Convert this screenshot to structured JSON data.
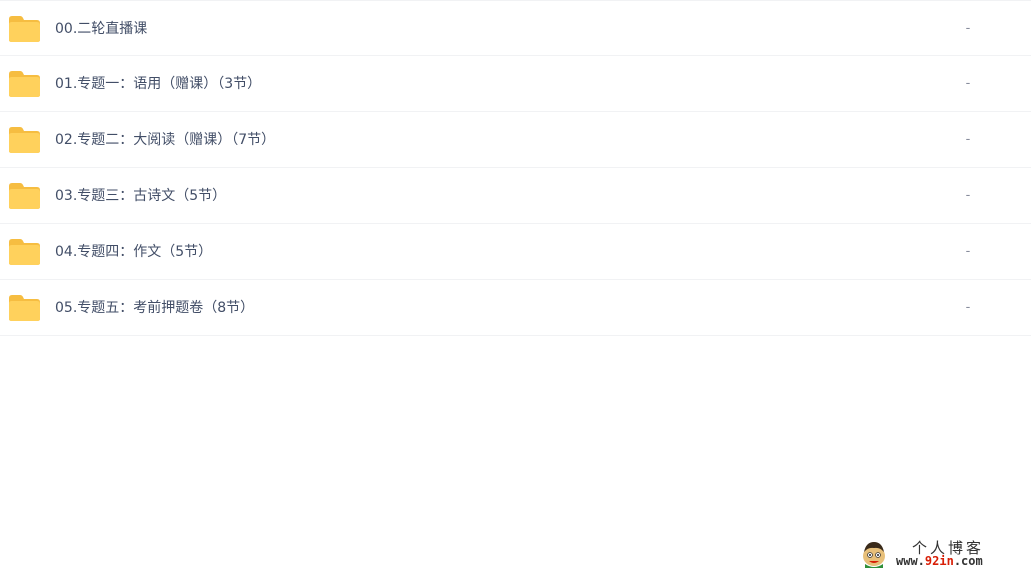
{
  "files": [
    {
      "name": "00.二轮直播课",
      "size": "-",
      "icon": "folder-icon"
    },
    {
      "name": "01.专题一：语用（赠课）（3节）",
      "size": "-",
      "icon": "folder-icon"
    },
    {
      "name": "02.专题二：大阅读（赠课）（7节）",
      "size": "-",
      "icon": "folder-icon"
    },
    {
      "name": "03.专题三：古诗文（5节）",
      "size": "-",
      "icon": "folder-icon"
    },
    {
      "name": "04.专题四：作文（5节）",
      "size": "-",
      "icon": "folder-icon"
    },
    {
      "name": "05.专题五：考前押题卷（8节）",
      "size": "-",
      "icon": "folder-icon"
    }
  ],
  "watermark": {
    "title": "个人博客",
    "url_prefix": "www.",
    "url_highlight": "92in",
    "url_suffix": ".com"
  },
  "colors": {
    "folder": "#ffd15c",
    "folder_tab": "#f6bd41",
    "text": "#424e67",
    "muted": "#878c9c",
    "divider": "#f1f2f4",
    "watermark_accent": "#d81e06"
  }
}
